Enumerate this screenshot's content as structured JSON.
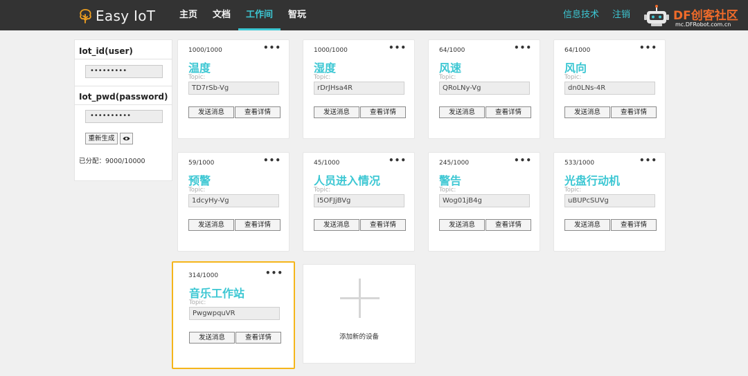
{
  "header": {
    "logo_text": "Easy IoT",
    "nav": [
      {
        "label": "主页"
      },
      {
        "label": "文档"
      },
      {
        "label": "工作间"
      },
      {
        "label": "智玩"
      }
    ],
    "right_links": {
      "info": "信息技术",
      "logout": "注销"
    },
    "brand": {
      "title": "DF创客社区",
      "url": "mc.DFRobot.com.cn"
    },
    "accent_color": "#3cc7d3",
    "header_bg": "#333333",
    "brand_color": "#f06b2a"
  },
  "credentials": {
    "user_label": "Iot_id(user)",
    "user_value": "•••••••••",
    "pwd_label": "Iot_pwd(password)",
    "pwd_value": "••••••••••",
    "regen_label": "重新生成",
    "show_icon": "eye-icon",
    "allotted": "已分配：9000/10000"
  },
  "devices": [
    {
      "count": "1000/1000",
      "name": "温度",
      "topic_label": "Topic:",
      "topic": "TD7rSb-Vg",
      "send_label": "发送消息",
      "detail_label": "查看详情"
    },
    {
      "count": "1000/1000",
      "name": "湿度",
      "topic_label": "Topic:",
      "topic": "rDrJHsa4R",
      "send_label": "发送消息",
      "detail_label": "查看详情"
    },
    {
      "count": "64/1000",
      "name": "风速",
      "topic_label": "Topic:",
      "topic": "QRoLNy-Vg",
      "send_label": "发送消息",
      "detail_label": "查看详情"
    },
    {
      "count": "64/1000",
      "name": "风向",
      "topic_label": "Topic:",
      "topic": "dn0LNs-4R",
      "send_label": "发送消息",
      "detail_label": "查看详情"
    },
    {
      "count": "59/1000",
      "name": "预警",
      "topic_label": "Topic:",
      "topic": "1dcyHy-Vg",
      "send_label": "发送消息",
      "detail_label": "查看详情"
    },
    {
      "count": "45/1000",
      "name": "人员进入情况",
      "topic_label": "Topic:",
      "topic": "I5OFJjBVg",
      "send_label": "发送消息",
      "detail_label": "查看详情"
    },
    {
      "count": "245/1000",
      "name": "警告",
      "topic_label": "Topic:",
      "topic": "Wog01jB4g",
      "send_label": "发送消息",
      "detail_label": "查看详情"
    },
    {
      "count": "533/1000",
      "name": "光盘行动机",
      "topic_label": "Topic:",
      "topic": "uBUPcSUVg",
      "send_label": "发送消息",
      "detail_label": "查看详情"
    },
    {
      "count": "314/1000",
      "name": "音乐工作站",
      "topic_label": "Topic:",
      "topic": "PwgwpquVR",
      "send_label": "发送消息",
      "detail_label": "查看详情",
      "selected": true
    }
  ],
  "add_device_label": "添加新的设备",
  "selected_border_color": "#f5b51a"
}
